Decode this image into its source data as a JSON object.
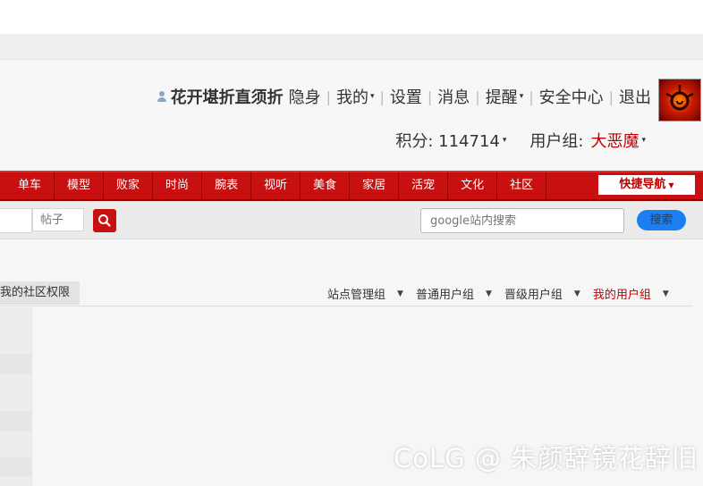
{
  "user": {
    "name": "花开堪折直须折",
    "links": [
      {
        "label": "隐身",
        "caret": false
      },
      {
        "label": "我的",
        "caret": true
      },
      {
        "label": "设置",
        "caret": false
      },
      {
        "label": "消息",
        "caret": false
      },
      {
        "label": "提醒",
        "caret": true
      },
      {
        "label": "安全中心",
        "caret": false
      },
      {
        "label": "退出",
        "caret": false
      }
    ],
    "score_label": "积分: 114714",
    "group_label": "用户组:",
    "group_name": "大恶魔"
  },
  "nav": {
    "items": [
      "单车",
      "模型",
      "败家",
      "时尚",
      "腕表",
      "视听",
      "美食",
      "家居",
      "活宠",
      "文化",
      "社区"
    ],
    "quick_nav": "快捷导航"
  },
  "search": {
    "type_label": "帖子",
    "google_placeholder": "google站内搜索",
    "google_button": "搜索"
  },
  "permissions": {
    "tab_label": "我的社区权限",
    "groups": [
      {
        "label": "站点管理组",
        "active": false
      },
      {
        "label": "普通用户组",
        "active": false
      },
      {
        "label": "晋级用户组",
        "active": false
      },
      {
        "label": "我的用户组",
        "active": true
      }
    ]
  },
  "watermark": "CoLG @ 朱颜辞镜花辞旧",
  "colors": {
    "nav_red": "#c81010",
    "group_red": "#c00000",
    "search_blue": "#1b7ff2"
  }
}
